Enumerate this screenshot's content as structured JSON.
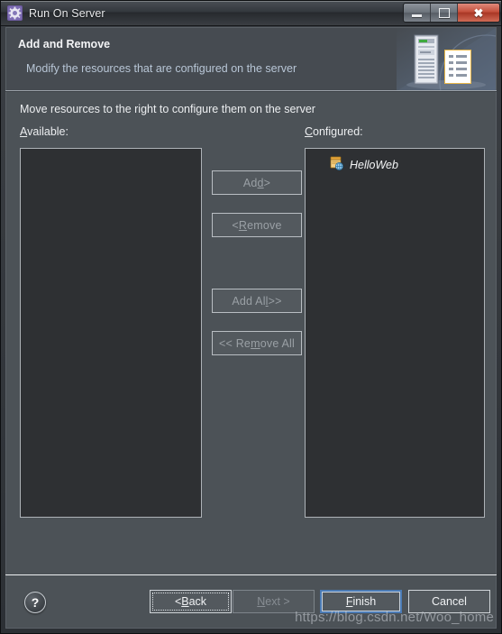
{
  "window": {
    "title": "Run On Server",
    "icon": "gear-icon",
    "controls": {
      "minimize": "minimize-icon",
      "maximize": "maximize-icon",
      "close": "close-icon"
    }
  },
  "header": {
    "title": "Add and Remove",
    "subtitle": "Modify the resources that are configured on the server",
    "illustration": "server-and-document-icon"
  },
  "main": {
    "instruction": "Move resources to the right to configure them on the server",
    "available": {
      "label_prefix": "",
      "label_mnemonic": "A",
      "label_suffix": "vailable:",
      "items": []
    },
    "configured": {
      "label_prefix": "",
      "label_mnemonic": "C",
      "label_suffix": "onfigured:",
      "items": [
        {
          "name": "HelloWeb",
          "icon": "web-module-icon"
        }
      ]
    },
    "transfer_buttons": [
      {
        "id": "add",
        "prefix": "Ad",
        "mnemonic": "d",
        "suffix": " >",
        "enabled": false
      },
      {
        "id": "remove",
        "prefix": "< ",
        "mnemonic": "R",
        "suffix": "emove",
        "enabled": false
      },
      {
        "id": "add-all",
        "prefix": "Add Al",
        "mnemonic": "l",
        "suffix": " >>",
        "enabled": false
      },
      {
        "id": "remove-all",
        "prefix": "<< Re",
        "mnemonic": "m",
        "suffix": "ove All",
        "enabled": false
      }
    ]
  },
  "footer": {
    "help": "?",
    "buttons": [
      {
        "id": "back",
        "prefix": "< ",
        "mnemonic": "B",
        "suffix": "ack",
        "enabled": true,
        "focused": true,
        "default": false
      },
      {
        "id": "next",
        "prefix": "",
        "mnemonic": "N",
        "suffix": "ext >",
        "enabled": false,
        "focused": false,
        "default": false
      },
      {
        "id": "finish",
        "prefix": "",
        "mnemonic": "F",
        "suffix": "inish",
        "enabled": true,
        "focused": false,
        "default": true
      },
      {
        "id": "cancel",
        "prefix": "",
        "mnemonic": "",
        "suffix": "Cancel",
        "enabled": true,
        "focused": false,
        "default": false
      }
    ]
  },
  "watermark": "https://blog.csdn.net/Woo_home",
  "colors": {
    "dialog_bg": "#4c5257",
    "header_bg": "#464b51",
    "list_bg": "#2e3033",
    "list_border": "#aeb3b8",
    "text": "#eceef0",
    "subtitle": "#b8c6d6",
    "disabled_text": "#9aa0a5",
    "default_button_border": "#4b7bb5",
    "close_button": "#c4503c"
  }
}
